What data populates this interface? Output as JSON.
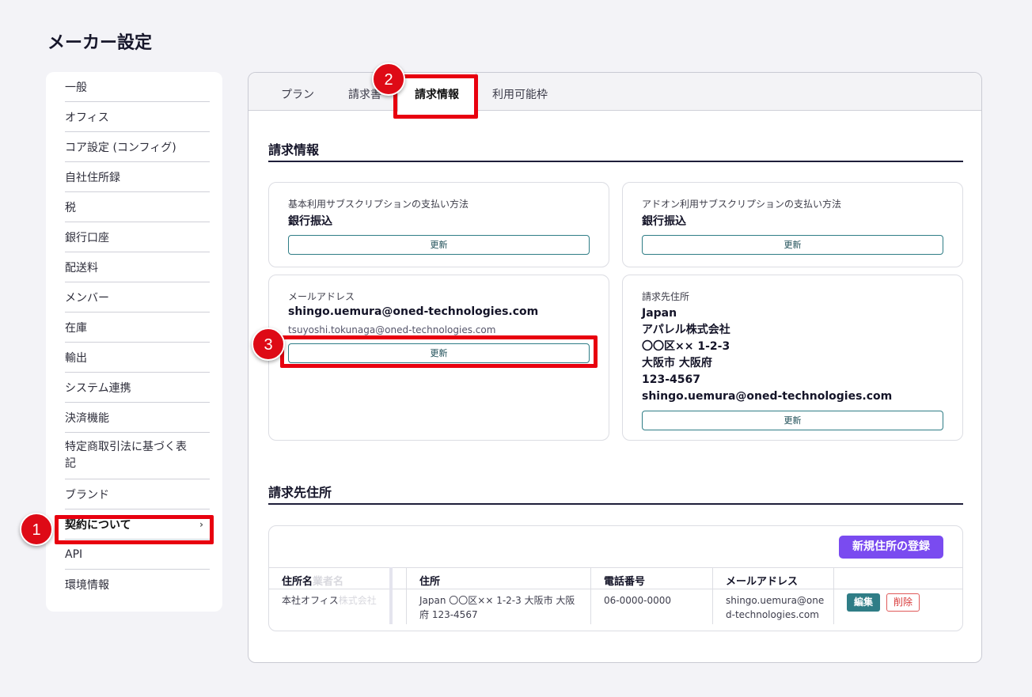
{
  "page": {
    "title": "メーカー設定"
  },
  "sidebar": {
    "items": [
      {
        "label": "一般"
      },
      {
        "label": "オフィス"
      },
      {
        "label": "コア設定 (コンフィグ)"
      },
      {
        "label": "自社住所録"
      },
      {
        "label": "税"
      },
      {
        "label": "銀行口座"
      },
      {
        "label": "配送料"
      },
      {
        "label": "メンバー"
      },
      {
        "label": "在庫"
      },
      {
        "label": "輸出"
      },
      {
        "label": "システム連携"
      },
      {
        "label": "決済機能"
      },
      {
        "label": "特定商取引法に基づく表記"
      },
      {
        "label": "ブランド"
      },
      {
        "label": "契約について",
        "chevron": "›"
      },
      {
        "label": "API"
      },
      {
        "label": "環境情報"
      }
    ]
  },
  "tabs": [
    {
      "label": "プラン"
    },
    {
      "label": "請求書"
    },
    {
      "label": "請求情報"
    },
    {
      "label": "利用可能枠"
    }
  ],
  "billing": {
    "section_title": "請求情報",
    "base_method": {
      "label": "基本利用サブスクリプションの支払い方法",
      "value": "銀行振込",
      "button": "更新"
    },
    "addon_method": {
      "label": "アドオン利用サブスクリプションの支払い方法",
      "value": "銀行振込",
      "button": "更新"
    },
    "email": {
      "label": "メールアドレス",
      "primary": "shingo.uemura@oned-technologies.com",
      "secondary": "tsuyoshi.tokunaga@oned-technologies.com",
      "button": "更新"
    },
    "address": {
      "label": "請求先住所",
      "lines": [
        "Japan",
        "アパレル株式会社",
        "〇〇区×× 1-2-3",
        "大阪市 大阪府",
        "123-4567",
        "shingo.uemura@oned-technologies.com"
      ],
      "button": "更新"
    }
  },
  "address_book": {
    "section_title": "請求先住所",
    "new_button": "新規住所の登録",
    "columns": {
      "name": "住所名",
      "name_ghost": "業者名",
      "address": "住所",
      "phone": "電話番号",
      "email": "メールアドレス"
    },
    "rows": [
      {
        "name": "本社オフィス",
        "name_ghost": "株式会社",
        "address": "Japan 〇〇区×× 1-2-3 大阪市 大阪府 123-4567",
        "phone": "06-0000-0000",
        "email": "shingo.uemura@oned-technologies.com",
        "edit": "編集",
        "delete": "削除"
      }
    ]
  },
  "annotations": {
    "badge1": "1",
    "badge2": "2",
    "badge3": "3"
  },
  "colors": {
    "highlight": "#e8000f",
    "primary": "#7a4bf0",
    "teal": "#2f7d86",
    "danger": "#d83a3a"
  }
}
